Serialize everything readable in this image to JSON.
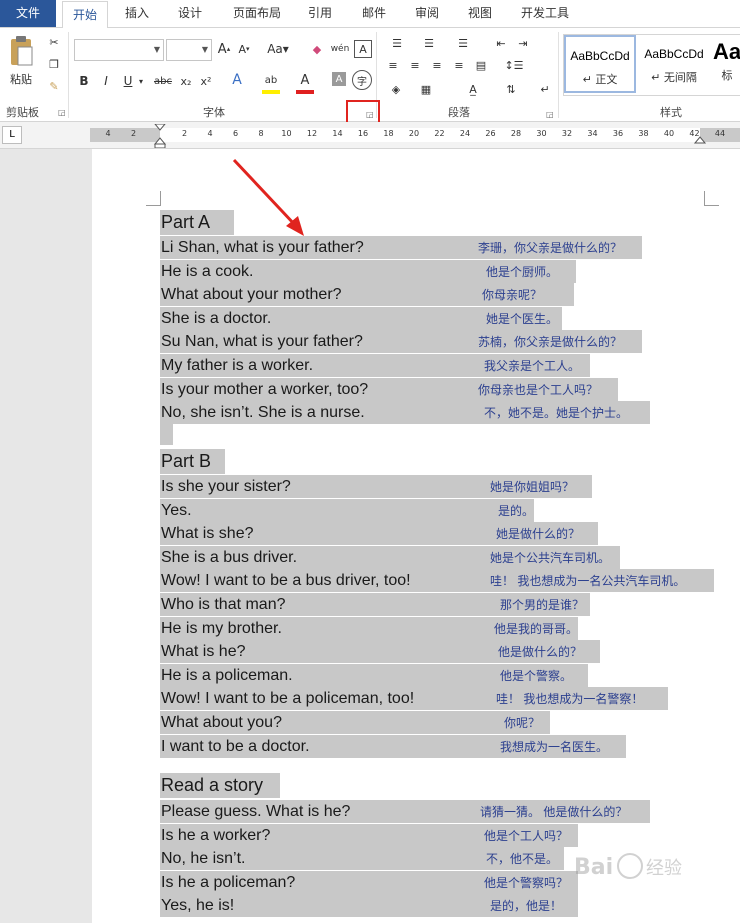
{
  "tabs": [
    "文件",
    "开始",
    "插入",
    "设计",
    "页面布局",
    "引用",
    "邮件",
    "审阅",
    "视图",
    "开发工具"
  ],
  "ribbon": {
    "clipboard": {
      "paste_label": "粘贴",
      "group_label": "剪贴板"
    },
    "font": {
      "group_label": "字体",
      "bold": "B",
      "italic": "I",
      "underline": "U",
      "strike": "abc",
      "sub": "x₂",
      "sup": "x²",
      "grow": "A",
      "shrink": "A",
      "case": "Aa",
      "phonetic": "wén",
      "border_char": "A",
      "highlight": "ab",
      "color": "A",
      "shading": "A",
      "enclose": "字"
    },
    "paragraph": {
      "group_label": "段落"
    },
    "styles": {
      "group_label": "样式",
      "items": [
        {
          "sample": "AaBbCcDd",
          "name": "↵ 正文"
        },
        {
          "sample": "AaBbCcDd",
          "name": "↵ 无间隔"
        },
        {
          "sample": "Aa",
          "name": "标"
        }
      ]
    }
  },
  "ruler": {
    "ticks": [
      "4",
      "2",
      "",
      "2",
      "4",
      "6",
      "8",
      "10",
      "12",
      "14",
      "16",
      "18",
      "20",
      "22",
      "24",
      "26",
      "28",
      "30",
      "32",
      "34",
      "36",
      "38",
      "40",
      "42",
      "44"
    ]
  },
  "document": {
    "part_a": {
      "heading": "Part A",
      "lines": [
        {
          "en": "Li Shan, what is your father?",
          "zh": "李珊，你父亲是做什么的？"
        },
        {
          "en": "He is a cook.",
          "zh": "他是个厨师。"
        },
        {
          "en": "What     about     your     mother?",
          "zh": "你母亲呢？"
        },
        {
          "en": "She is a doctor.",
          "zh": "她是个医生。"
        },
        {
          "en": "Su Nan, what is your father?",
          "zh": "苏楠，你父亲是做什么的？"
        },
        {
          "en": "My father is a worker.",
          "zh": "我父亲是个工人。"
        },
        {
          "en": "Is your mother a worker, too?",
          "zh": "你母亲也是个工人吗？"
        },
        {
          "en": "No, she isn’t. She is a nurse.",
          "zh": "不，她不是。她是个护士。"
        }
      ]
    },
    "part_b": {
      "heading": "Part B",
      "lines": [
        {
          "en": "Is she your sister?",
          "zh": "她是你姐姐吗？"
        },
        {
          "en": "Yes.",
          "zh": "是的。"
        },
        {
          "en": "What is she?",
          "zh": "她是做什么的？"
        },
        {
          "en": "She is a bus driver.",
          "zh": "她是个公共汽车司机。"
        },
        {
          "en": "Wow! I want to be a bus driver, too!",
          "zh": "哇！  我也想成为一名公共汽车司机。"
        },
        {
          "en": "Who is that man?",
          "zh": "那个男的是谁？"
        },
        {
          "en": "He is my brother.",
          "zh": "他是我的哥哥。"
        },
        {
          "en": "What is he?",
          "zh": "他是做什么的？"
        },
        {
          "en": "He is a policeman.",
          "zh": "他是个警察。"
        },
        {
          "en": "Wow! I want to be a policeman, too!",
          "zh": "哇！  我也想成为一名警察！"
        },
        {
          "en": "What     about     you?",
          "zh": "你呢？"
        },
        {
          "en": "I want to be a doctor.",
          "zh": "我想成为一名医生。"
        }
      ]
    },
    "story": {
      "heading": "Read a story",
      "lines": [
        {
          "en": "Please guess. What is he?",
          "zh": "请猜一猜。  他是做什么的？"
        },
        {
          "en": "Is he a worker?",
          "zh": "他是个工人吗？"
        },
        {
          "en": "No, he isn’t.",
          "zh": "不，他不是。"
        },
        {
          "en": "Is he a policeman?",
          "zh": "他是个警察吗？"
        },
        {
          "en": "Yes, he is!",
          "zh": "是的，他是！"
        }
      ]
    }
  },
  "watermark": "Baidu 经验"
}
